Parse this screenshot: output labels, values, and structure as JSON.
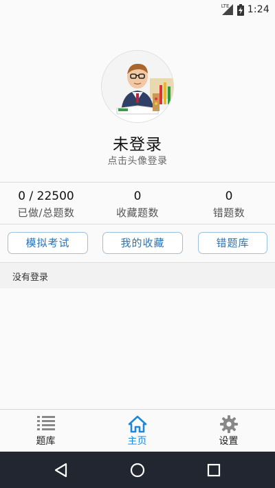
{
  "status_bar": {
    "network": "LTE",
    "time": "1:24"
  },
  "profile": {
    "title": "未登录",
    "subtitle": "点击头像登录",
    "avatar_icon": "student-avatar"
  },
  "stats": [
    {
      "value": "0 / 22500",
      "label": "已做/总题数"
    },
    {
      "value": "0",
      "label": "收藏题数"
    },
    {
      "value": "0",
      "label": "错题数"
    }
  ],
  "actions": {
    "mock_exam": "模拟考试",
    "favorites": "我的收藏",
    "wrong_questions": "错题库"
  },
  "info": {
    "message": "没有登录"
  },
  "bottom_nav": {
    "items": [
      {
        "label": "题库",
        "icon": "list-icon"
      },
      {
        "label": "主页",
        "icon": "home-icon",
        "active": true
      },
      {
        "label": "设置",
        "icon": "gear-icon"
      }
    ]
  },
  "colors": {
    "accent": "#1e88d8",
    "button_text": "#2a73b8",
    "button_border": "#9bbfe0",
    "system_nav": "#222630"
  }
}
